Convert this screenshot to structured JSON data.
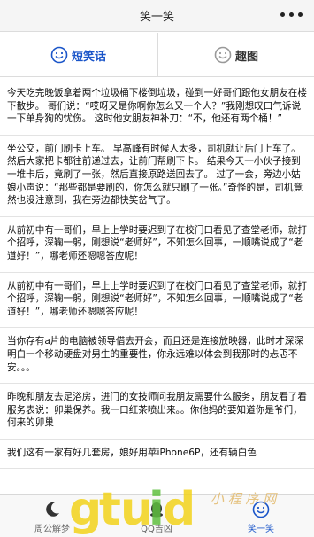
{
  "header": {
    "title": "笑一笑",
    "more_icon": "more-dots-icon"
  },
  "tabs": [
    {
      "label": "短笑话",
      "icon": "smiley-icon",
      "active": true
    },
    {
      "label": "趣图",
      "icon": "smiley-icon",
      "active": false
    }
  ],
  "posts": [
    "今天吃完晚饭拿着两个垃圾桶下楼倒垃圾，碰到一好哥们跟他女朋友在楼下散步。 哥们说：“哎呀又是你啊你怎么又一个人？”我刚想叹口气诉说一下单身狗的忧伤。 这时他女朋友神补刀：“不，他还有两个桶！”",
    "坐公交，前门刷卡上车。 早高峰有时候人太多，司机就让后门上车了。 然后大家把卡都往前递过去，让前门帮刷下卡。 结果今天一小伙子接到一堆卡后，竟刷了一张，然后直接原路送回去了。 过了一会，旁边小姑娘小声说：“那些都是要刷的，你怎么就只刷了一张。”奇怪的是，司机竟然也没注意到，我在旁边都快笑岔气了。",
    "从前初中有一哥们，早上上学时要迟到了在校门口看见了查堂老师，就打个招呼，深鞠一躬，刚想说“老师好”，不知怎么回事，一顺嘴说成了“老道好！”，哪老师还嗯嗯答应呢！",
    "从前初中有一哥们，早上上学时要迟到了在校门口看见了查堂老师，就打个招呼，深鞠一躬，刚想说“老师好”，不知怎么回事，一顺嘴说成了“老道好！”，哪老师还嗯嗯答应呢！",
    "当你存有a片的电脑被领导借去开会，而且还是连接放映器，此时才深深明白一个移动硬盘对男生的重要性，你永远难以体会到我那时的忐忑不安。。。",
    "昨晚和朋友去足浴房，进门的女技师问我朋友需要什么服务，朋友看了看服务表说：卯巢保养。我一口红茶喷出来。。你他妈的要知道你是爷们，何来的卯巢",
    "我们这有一家有好几套房，娘好用苹iPhone6P，还有辆白色"
  ],
  "bottom_nav": [
    {
      "label": "周公解梦",
      "icon": "moon-icon",
      "active": false
    },
    {
      "label": "QQ吉凶",
      "icon": "qq-icon",
      "active": false
    },
    {
      "label": "笑一笑",
      "icon": "smiley-icon",
      "active": true
    }
  ],
  "watermark": {
    "text": "小 程 序 网",
    "logo_text": "gtuid"
  },
  "colors": {
    "accent": "#1a55c9",
    "watermark_yellow": "#f2d21a",
    "watermark_green": "#5fbf3f"
  }
}
